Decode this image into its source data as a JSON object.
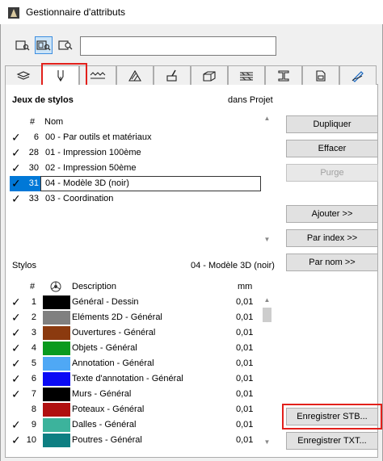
{
  "window": {
    "title": "Gestionnaire d'attributs"
  },
  "mode_buttons": [
    {
      "icon": "view-list-icon"
    },
    {
      "icon": "view-attributes-icon",
      "active": true
    },
    {
      "icon": "view-search-icon"
    }
  ],
  "search": {
    "value": "",
    "placeholder": ""
  },
  "tabs": [
    {
      "icon": "layers-icon"
    },
    {
      "icon": "pen-icon",
      "active": true
    },
    {
      "icon": "line-types-icon"
    },
    {
      "icon": "fill-icon"
    },
    {
      "icon": "surface-brush-icon"
    },
    {
      "icon": "building-materials-icon"
    },
    {
      "icon": "composites-icon"
    },
    {
      "icon": "profiles-icon"
    },
    {
      "icon": "zones-icon"
    },
    {
      "icon": "renovation-icon"
    }
  ],
  "pensets": {
    "title": "Jeux de stylos",
    "location": "dans Projet",
    "col_num": "#",
    "col_name": "Nom",
    "rows": [
      {
        "checked": true,
        "num": "6",
        "name": "00 - Par outils et matériaux"
      },
      {
        "checked": true,
        "num": "28",
        "name": "01 - Impression 100ème"
      },
      {
        "checked": true,
        "num": "30",
        "name": "02 - Impression 50ème"
      },
      {
        "checked": true,
        "num": "31",
        "name": "04 - Modèle 3D (noir)",
        "selected": true
      },
      {
        "checked": true,
        "num": "33",
        "name": "03 - Coordination"
      }
    ]
  },
  "pens": {
    "title": "Stylos",
    "current_set": "04 - Modèle 3D (noir)",
    "col_num": "#",
    "col_desc": "Description",
    "col_mm": "mm",
    "rows": [
      {
        "checked": true,
        "num": "1",
        "color": "#000000",
        "desc": "Général - Dessin",
        "mm": "0,01"
      },
      {
        "checked": true,
        "num": "2",
        "color": "#808080",
        "desc": "Eléments 2D - Général",
        "mm": "0,01"
      },
      {
        "checked": true,
        "num": "3",
        "color": "#8b3a0f",
        "desc": "Ouvertures - Général",
        "mm": "0,01"
      },
      {
        "checked": true,
        "num": "4",
        "color": "#0a9a1e",
        "desc": "Objets - Général",
        "mm": "0,01"
      },
      {
        "checked": true,
        "num": "5",
        "color": "#4fa8f5",
        "desc": "Annotation - Général",
        "mm": "0,01"
      },
      {
        "checked": true,
        "num": "6",
        "color": "#0b0bf5",
        "desc": "Texte d'annotation - Général",
        "mm": "0,01"
      },
      {
        "checked": true,
        "num": "7",
        "color": "#000000",
        "desc": "Murs - Général",
        "mm": "0,01"
      },
      {
        "checked": false,
        "num": "8",
        "color": "#b01010",
        "desc": "Poteaux - Général",
        "mm": "0,01"
      },
      {
        "checked": true,
        "num": "9",
        "color": "#3cb39c",
        "desc": "Dalles - Général",
        "mm": "0,01"
      },
      {
        "checked": true,
        "num": "10",
        "color": "#0e7f82",
        "desc": "Poutres - Général",
        "mm": "0,01"
      }
    ]
  },
  "buttons": {
    "duplicate": "Dupliquer",
    "delete": "Effacer",
    "purge": "Purge",
    "add": "Ajouter >>",
    "by_index": "Par index >>",
    "by_name": "Par nom >>",
    "save_stb": "Enregistrer STB...",
    "save_txt": "Enregistrer TXT..."
  },
  "highlight_color": "#e2201b",
  "selection_color": "#0078d7"
}
